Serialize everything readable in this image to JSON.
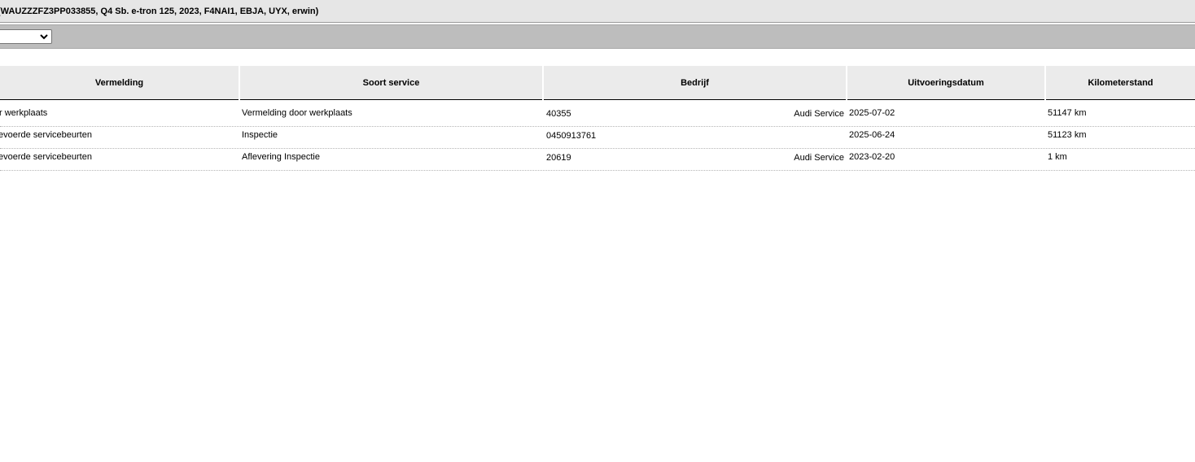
{
  "title": "(WAUZZZFZ3PP033855, Q4 Sb. e-tron 125, 2023, F4NAI1, EBJA, UYX, erwin)",
  "toolbar": {
    "select_value": ""
  },
  "table": {
    "headers": {
      "vermelding": "Vermelding",
      "soort_service": "Soort service",
      "bedrijf": "Bedrijf",
      "uitvoeringsdatum": "Uitvoeringsdatum",
      "kilometerstand": "Kilometerstand"
    },
    "rows": [
      {
        "vermelding": "r werkplaats",
        "soort_service": "Vermelding door werkplaats",
        "bedrijf_code": "40355",
        "bedrijf_name": "Audi Service",
        "datum": "2025-07-02",
        "km": "51147 km"
      },
      {
        "vermelding": "evoerde servicebeurten",
        "soort_service": "Inspectie",
        "bedrijf_code": "0450913761",
        "bedrijf_name": "",
        "datum": "2025-06-24",
        "km": "51123 km"
      },
      {
        "vermelding": "evoerde servicebeurten",
        "soort_service": "Aflevering Inspectie",
        "bedrijf_code": "20619",
        "bedrijf_name": "Audi Service",
        "datum": "2023-02-20",
        "km": "1 km"
      }
    ]
  }
}
